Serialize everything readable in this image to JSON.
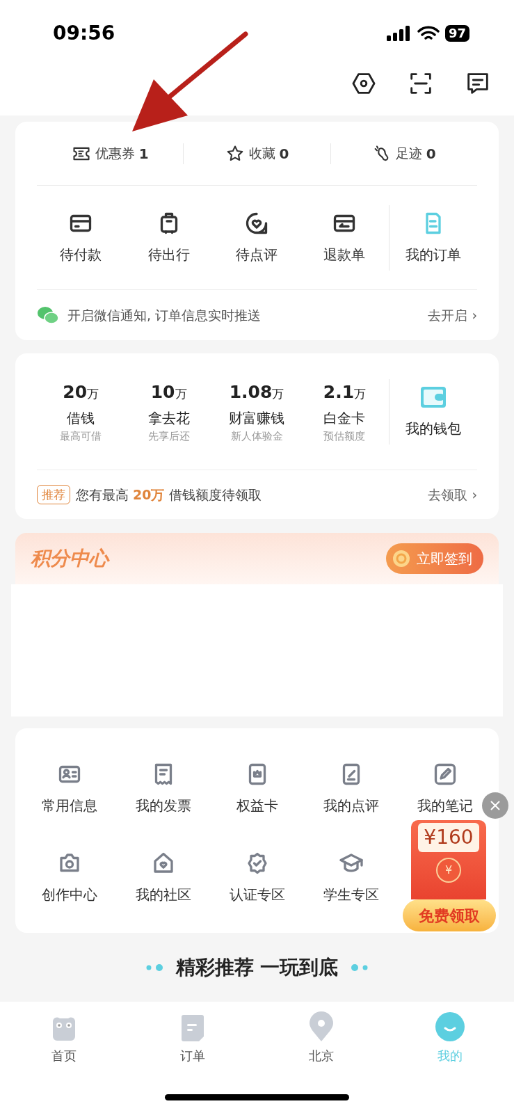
{
  "status_bar": {
    "time": "09:56",
    "battery": "97"
  },
  "stats": [
    {
      "label": "优惠券",
      "count": "1",
      "kind": "coupon"
    },
    {
      "label": "收藏",
      "count": "0",
      "kind": "star"
    },
    {
      "label": "足迹",
      "count": "0",
      "kind": "footprint"
    }
  ],
  "orders": [
    {
      "label": "待付款",
      "kind": "card"
    },
    {
      "label": "待出行",
      "kind": "luggage"
    },
    {
      "label": "待点评",
      "kind": "heart-chat"
    },
    {
      "label": "退款单",
      "kind": "refund"
    }
  ],
  "my_orders": {
    "label": "我的订单"
  },
  "notice": {
    "text": "开启微信通知, 订单信息实时推送",
    "action": "去开启",
    "chevron": "›"
  },
  "finance": [
    {
      "amount": "20",
      "unit": "万",
      "label": "借钱",
      "sub": "最高可借"
    },
    {
      "amount": "10",
      "unit": "万",
      "label": "拿去花",
      "sub": "先享后还"
    },
    {
      "amount": "1.08",
      "unit": "万",
      "label": "财富赚钱",
      "sub": "新人体验金"
    },
    {
      "amount": "2.1",
      "unit": "万",
      "label": "白金卡",
      "sub": "预估额度"
    }
  ],
  "wallet": {
    "label": "我的钱包"
  },
  "promo": {
    "tag": "推荐",
    "text": "您有最高 **20万** 借钱额度待领取",
    "action": "去领取",
    "chevron": "›"
  },
  "points": {
    "title": "积分中心",
    "button": "立即签到"
  },
  "tools": [
    {
      "label": "常用信息",
      "kind": "id-card"
    },
    {
      "label": "我的发票",
      "kind": "receipt"
    },
    {
      "label": "权益卡",
      "kind": "crown-card"
    },
    {
      "label": "我的点评",
      "kind": "pen-doc"
    },
    {
      "label": "我的笔记",
      "kind": "pencil-box"
    },
    {
      "label": "创作中心",
      "kind": "camera"
    },
    {
      "label": "我的社区",
      "kind": "home-heart"
    },
    {
      "label": "认证专区",
      "kind": "badge-check"
    },
    {
      "label": "学生专区",
      "kind": "grad-cap"
    }
  ],
  "red_packet": {
    "amount": "¥160",
    "coin": "¥",
    "button": "免费领取"
  },
  "recommend": {
    "title": "精彩推荐 一玩到底"
  },
  "tab_bar": [
    {
      "label": "首页",
      "kind": "home",
      "selected": false
    },
    {
      "label": "订单",
      "kind": "orders",
      "selected": false
    },
    {
      "label": "北京",
      "kind": "location",
      "selected": false
    },
    {
      "label": "我的",
      "kind": "mine",
      "selected": true
    }
  ]
}
